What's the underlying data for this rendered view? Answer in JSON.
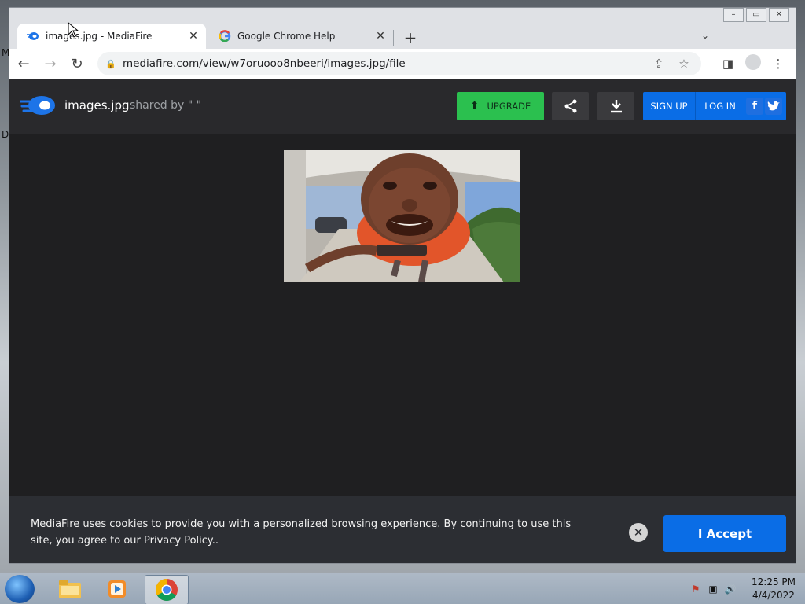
{
  "desktop": {
    "side_letters": [
      "M",
      "D"
    ]
  },
  "window_controls": {
    "minimize": "–",
    "restore": "▭",
    "close": "✕"
  },
  "tabs": [
    {
      "title": "images.jpg - MediaFire",
      "close": "✕",
      "active": true,
      "favicon": "mediafire-icon"
    },
    {
      "title": "Google Chrome Help",
      "close": "✕",
      "active": false,
      "favicon": "google-icon"
    }
  ],
  "new_tab": "+",
  "tab_list": "⌄",
  "toolbar": {
    "back": "←",
    "forward": "→",
    "reload": "↻"
  },
  "omnibox": {
    "url": "mediafire.com/view/w7oruooo8nbeeri/images.jpg/file",
    "lock": "🔒",
    "share": "⇪",
    "bookmark": "☆"
  },
  "toolbar_right": {
    "side_panel": "◨",
    "menu": "⋮"
  },
  "mediafire": {
    "filename": "images.jpg",
    "shared_by": "shared by \" \"",
    "upgrade_label": "UPGRADE",
    "signup_label": "SIGN UP",
    "login_label": "LOG IN",
    "facebook": "f",
    "twitter": "t",
    "accent_blue": "#0a6de6",
    "accent_green": "#2bc04f"
  },
  "cookie_banner": {
    "text": "MediaFire uses cookies to provide you with a personalized browsing experience. By continuing to use this site, you agree to our Privacy Policy..",
    "close": "✕",
    "accept_label": "I Accept"
  },
  "taskbar": {
    "items": [
      "explorer-icon",
      "media-player-icon",
      "chrome-icon"
    ],
    "tray": {
      "flag": "⚑",
      "network": "▣",
      "volume": "🔊"
    },
    "time": "12:25 PM",
    "date": "4/4/2022"
  }
}
